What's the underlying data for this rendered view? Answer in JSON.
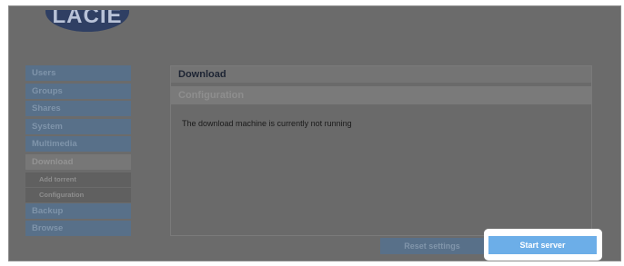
{
  "brand": {
    "logo_text": "LACIE"
  },
  "sidebar": {
    "items": [
      {
        "label": "Users"
      },
      {
        "label": "Groups"
      },
      {
        "label": "Shares"
      },
      {
        "label": "System"
      },
      {
        "label": "Multimedia"
      },
      {
        "label": "Download",
        "active": true
      },
      {
        "label": "Backup"
      },
      {
        "label": "Browse"
      }
    ],
    "download_subitems": [
      {
        "label": "Add torrent"
      },
      {
        "label": "Configuration"
      }
    ]
  },
  "main": {
    "title": "Download",
    "section": "Configuration",
    "status_message": "The download machine is currently not running"
  },
  "actions": {
    "reset_label": "Reset settings",
    "start_label": "Start server"
  },
  "colors": {
    "nav_blue": "#587089",
    "start_button": "#6caee8",
    "overlay_gray": "#6b6b6b"
  }
}
